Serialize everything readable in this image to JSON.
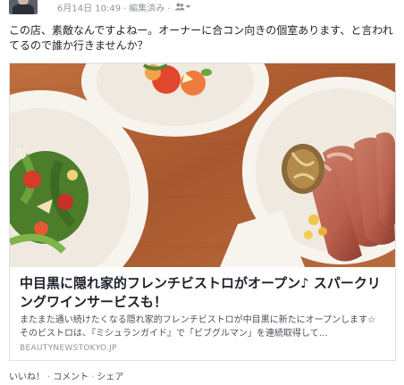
{
  "post": {
    "date": "6月14日 10:49",
    "edited": "編集済み",
    "separator": "·",
    "body": "この店、素敵なんですよねー。オーナーに合コン向きの個室あります、と言われてるので誰か行きませんか？"
  },
  "link_card": {
    "title": "中目黒に隠れ家的フレンチビストロがオープン♪ スパークリングワインサービスも！",
    "description": "またまた通い続けたくなる隠れ家的フレンチビストロが中目黒に新たにオープンします☆　そのビストロは、『ミシュランガイド』で「ビブグルマン」を連続取得して…",
    "domain": "BEAUTYNEWSTOKYO.JP"
  },
  "actions": {
    "like": "いいね！",
    "comment": "コメント",
    "share": "シェア",
    "separator": "·"
  },
  "icons": {
    "audience": "friends-icon",
    "dropdown": "chevron-down-icon"
  },
  "colors": {
    "table": "#b5643a",
    "plate": "#f7f4ee",
    "meta_text": "#90949c",
    "border": "#dddfe2"
  }
}
